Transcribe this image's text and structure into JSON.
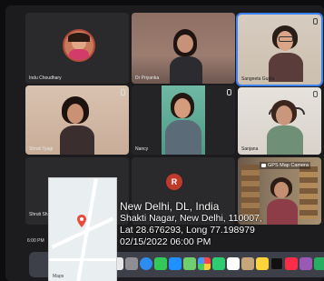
{
  "participants": [
    {
      "name": "Indu Choudhary"
    },
    {
      "name": "Dr Priyanka"
    },
    {
      "name": "Sangeeta Gupta"
    },
    {
      "name": "Shruti Tyagi"
    },
    {
      "name": "Nancy"
    },
    {
      "name": "Sanjana"
    },
    {
      "name": "Shruti Sh"
    }
  ],
  "r_badge": "R",
  "clock": "6:00 PM",
  "gps": {
    "label": "GPS Map Camera",
    "city": "New Delhi, DL, India",
    "address": "Shakti Nagar, New Delhi, 110007,",
    "coords": "Lat 28.676293, Long 77.198979",
    "datetime": "02/15/2022 06:00 PM",
    "map_credit": "Maps"
  },
  "colors": {
    "active_outline": "#3a82f7",
    "badge": "#c0392b",
    "pin": "#e74c3c"
  }
}
